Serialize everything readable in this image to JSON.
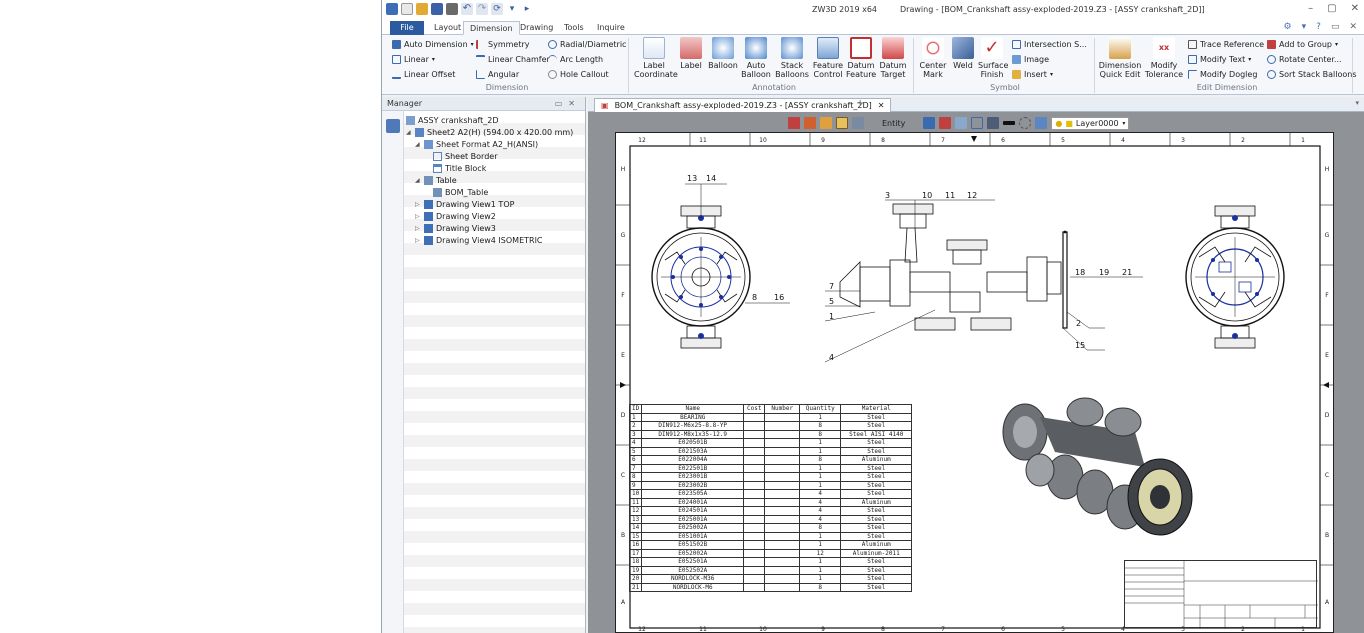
{
  "titlebar": {
    "app": "ZW3D 2019 x64",
    "doc": "Drawing - [BOM_Crankshaft assy-exploded-2019.Z3 - [ASSY crankshaft_2D]]"
  },
  "menu": {
    "tabs": [
      "File",
      "Layout",
      "Dimension",
      "Drawing",
      "Tools",
      "Inquire"
    ],
    "active": "Dimension"
  },
  "ribbon": {
    "dimension": {
      "items": [
        "Auto Dimension",
        "Linear",
        "Linear Offset",
        "Symmetry",
        "Linear Chamfer",
        "Angular",
        "Radial/Diametric",
        "Arc Length",
        "Hole Callout"
      ],
      "group": "Dimension"
    },
    "annotation": {
      "items": [
        "Label Coordinate",
        "Label",
        "Balloon",
        "Auto Balloon",
        "Stack Balloons",
        "Feature Control",
        "Datum Feature",
        "Datum Target"
      ],
      "group": "Annotation"
    },
    "symbol": {
      "items": [
        "Center Mark",
        "Weld",
        "Surface Finish",
        "Intersection S...",
        "Image",
        "Insert"
      ],
      "group": "Symbol"
    },
    "edit": {
      "items": [
        "Dimension Quick Edit",
        "Modify Tolerance",
        "Trace Reference",
        "Modify Text",
        "Modify Dogleg",
        "Add to Group",
        "Rotate Center...",
        "Sort Stack Balloons"
      ],
      "group": "Edit Dimension"
    }
  },
  "manager": {
    "title": "Manager",
    "tree": [
      "ASSY crankshaft_2D",
      "Sheet2 A2(H) (594.00 x 420.00 mm)",
      "Sheet Format A2_H(ANSI)",
      "Sheet Border",
      "Title Block",
      "Table",
      "BOM_Table",
      "Drawing View1 TOP",
      "Drawing View2",
      "Drawing View3",
      "Drawing View4 ISOMETRIC"
    ]
  },
  "doc": {
    "tab": "BOM_Crankshaft assy-exploded-2019.Z3 - [ASSY crankshaft_2D]",
    "close": "✕",
    "entity": "Entity",
    "layer": "Layer0000"
  },
  "sheet": {
    "top_cols": [
      "12",
      "11",
      "10",
      "9",
      "8",
      "7",
      "6",
      "5",
      "4",
      "3",
      "2",
      "1"
    ],
    "rows": [
      "H",
      "G",
      "F",
      "E",
      "D",
      "C",
      "B",
      "A"
    ],
    "balloons": [
      "13",
      "14",
      "3",
      "10",
      "11",
      "12",
      "7",
      "5",
      "1",
      "4",
      "8",
      "16",
      "18",
      "19",
      "21",
      "2",
      "15"
    ]
  },
  "bom": {
    "headers": [
      "ID",
      "Name",
      "Cost",
      "Number",
      "Quantity",
      "Material"
    ],
    "rows": [
      [
        "1",
        "BEARING",
        "",
        "",
        "1",
        "Steel"
      ],
      [
        "2",
        "DIN912-M6x25-8.8-YP",
        "",
        "",
        "8",
        "Steel"
      ],
      [
        "3",
        "DIN912-M8x1x35-12.9",
        "",
        "",
        "8",
        "Steel AISI 4140"
      ],
      [
        "4",
        "E020501B",
        "",
        "",
        "1",
        "Steel"
      ],
      [
        "5",
        "E021503A",
        "",
        "",
        "1",
        "Steel"
      ],
      [
        "6",
        "E022004A",
        "",
        "",
        "8",
        "Aluminum"
      ],
      [
        "7",
        "E022501B",
        "",
        "",
        "1",
        "Steel"
      ],
      [
        "8",
        "E023001B",
        "",
        "",
        "1",
        "Steel"
      ],
      [
        "9",
        "E023002B",
        "",
        "",
        "1",
        "Steel"
      ],
      [
        "10",
        "E023505A",
        "",
        "",
        "4",
        "Steel"
      ],
      [
        "11",
        "E024001A",
        "",
        "",
        "4",
        "Aluminum"
      ],
      [
        "12",
        "E024501A",
        "",
        "",
        "4",
        "Steel"
      ],
      [
        "13",
        "E025001A",
        "",
        "",
        "4",
        "Steel"
      ],
      [
        "14",
        "E025002A",
        "",
        "",
        "8",
        "Steel"
      ],
      [
        "15",
        "E051001A",
        "",
        "",
        "1",
        "Steel"
      ],
      [
        "16",
        "E051502B",
        "",
        "",
        "1",
        "Aluminum"
      ],
      [
        "17",
        "E052002A",
        "",
        "",
        "12",
        "Aluminum-2011"
      ],
      [
        "18",
        "E052501A",
        "",
        "",
        "1",
        "Steel"
      ],
      [
        "19",
        "E052502A",
        "",
        "",
        "1",
        "Steel"
      ],
      [
        "20",
        "NORDLOCK-M36",
        "",
        "",
        "1",
        "Steel"
      ],
      [
        "21",
        "NORDLOCK-M6",
        "",
        "",
        "8",
        "Steel"
      ]
    ]
  }
}
